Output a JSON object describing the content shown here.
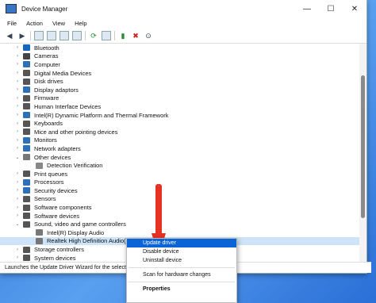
{
  "window": {
    "title": "Device Manager"
  },
  "menu": [
    "File",
    "Action",
    "View",
    "Help"
  ],
  "window_controls": {
    "minimize": "—",
    "maximize": "☐",
    "close": "✕"
  },
  "tree": [
    {
      "label": "Bluetooth",
      "color": "#1565c0",
      "level": 0,
      "chev": "›"
    },
    {
      "label": "Cameras",
      "color": "#444",
      "level": 0,
      "chev": "›"
    },
    {
      "label": "Computer",
      "color": "#2d6fb8",
      "level": 0,
      "chev": "›"
    },
    {
      "label": "Digital Media Devices",
      "color": "#555",
      "level": 0,
      "chev": "›"
    },
    {
      "label": "Disk drives",
      "color": "#555",
      "level": 0,
      "chev": "›"
    },
    {
      "label": "Display adaptors",
      "color": "#2d6fb8",
      "level": 0,
      "chev": "›"
    },
    {
      "label": "Firmware",
      "color": "#555",
      "level": 0,
      "chev": "›"
    },
    {
      "label": "Human Interface Devices",
      "color": "#555",
      "level": 0,
      "chev": "›"
    },
    {
      "label": "Intel(R) Dynamic Platform and Thermal Framework",
      "color": "#2d6fb8",
      "level": 0,
      "chev": "›"
    },
    {
      "label": "Keyboards",
      "color": "#555",
      "level": 0,
      "chev": "›"
    },
    {
      "label": "Mice and other pointing devices",
      "color": "#555",
      "level": 0,
      "chev": "›"
    },
    {
      "label": "Monitors",
      "color": "#2d6fb8",
      "level": 0,
      "chev": "›"
    },
    {
      "label": "Network adapters",
      "color": "#2d6fb8",
      "level": 0,
      "chev": "›"
    },
    {
      "label": "Other devices",
      "color": "#777",
      "level": 0,
      "chev": "⌄"
    },
    {
      "label": "Detection Verification",
      "color": "#888",
      "level": 1,
      "chev": ""
    },
    {
      "label": "Print queues",
      "color": "#555",
      "level": 0,
      "chev": "›"
    },
    {
      "label": "Processors",
      "color": "#2d6fb8",
      "level": 0,
      "chev": "›"
    },
    {
      "label": "Security devices",
      "color": "#2d6fb8",
      "level": 0,
      "chev": "›"
    },
    {
      "label": "Sensors",
      "color": "#555",
      "level": 0,
      "chev": "›"
    },
    {
      "label": "Software components",
      "color": "#555",
      "level": 0,
      "chev": "›"
    },
    {
      "label": "Software devices",
      "color": "#555",
      "level": 0,
      "chev": "›"
    },
    {
      "label": "Sound, video and game controllers",
      "color": "#555",
      "level": 0,
      "chev": "⌄"
    },
    {
      "label": "Intel(R) Display Audio",
      "color": "#777",
      "level": 1,
      "chev": ""
    },
    {
      "label": "Realtek High Definition Audio(SST)",
      "color": "#777",
      "level": 1,
      "chev": "",
      "selected": true
    },
    {
      "label": "Storage controllers",
      "color": "#555",
      "level": 0,
      "chev": "›"
    },
    {
      "label": "System devices",
      "color": "#555",
      "level": 0,
      "chev": "›"
    }
  ],
  "status": {
    "text": "Launches the Update Driver Wizard for the selecte"
  },
  "context_menu": {
    "update": "Update driver",
    "disable": "Disable device",
    "uninstall": "Uninstall device",
    "scan": "Scan for hardware changes",
    "properties": "Properties"
  },
  "arrow_color": "#e53224"
}
